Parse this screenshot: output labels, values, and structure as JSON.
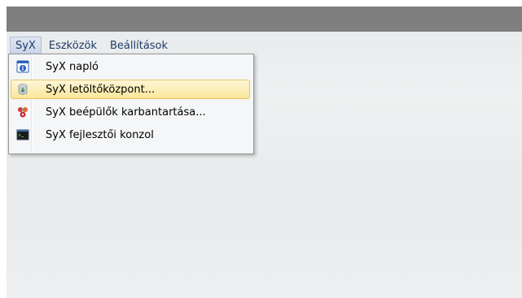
{
  "menubar": {
    "items": [
      {
        "label": "SyX"
      },
      {
        "label": "Eszközök"
      },
      {
        "label": "Beállítások"
      }
    ]
  },
  "dropdown": {
    "items": [
      {
        "label": "SyX napló",
        "icon": "log-icon"
      },
      {
        "label": "SyX letöltőközpont...",
        "icon": "download-center-icon"
      },
      {
        "label": "SyX beépülők karbantartása...",
        "icon": "plugins-icon"
      },
      {
        "label": "SyX fejlesztői konzol",
        "icon": "console-icon"
      }
    ]
  },
  "colors": {
    "titlebar": "#7f7f7f",
    "menu_text": "#1e3a66",
    "highlight": "#fbe79b"
  }
}
